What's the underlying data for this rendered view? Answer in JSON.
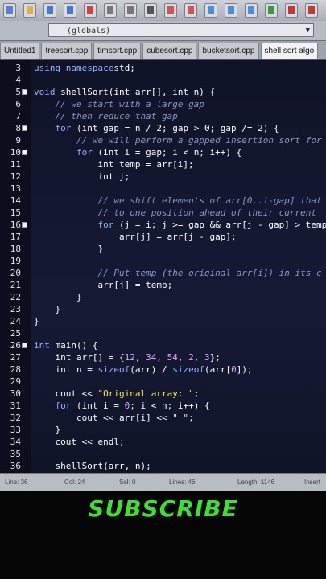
{
  "toolbar": {
    "icons": [
      "new-icon",
      "open-icon",
      "save-icon",
      "save-all-icon",
      "cut-icon",
      "copy-icon",
      "paste-icon",
      "print-icon",
      "undo-icon",
      "redo-icon",
      "find-icon",
      "replace-icon",
      "goto-icon",
      "run-icon",
      "debug-icon",
      "close-icon"
    ]
  },
  "scope": {
    "value": "(globals)"
  },
  "tabs": [
    {
      "label": "Untitled1"
    },
    {
      "label": "treesort.cpp"
    },
    {
      "label": "timsort.cpp"
    },
    {
      "label": "cubesort.cpp"
    },
    {
      "label": "bucketsort.cpp"
    },
    {
      "label": "shell sort algo"
    }
  ],
  "lines": [
    {
      "n": "3",
      "fold": "",
      "tokens": [
        [
          "kw",
          "using namespace"
        ],
        [
          "",
          "std;"
        ]
      ]
    },
    {
      "n": "4",
      "fold": "",
      "tokens": []
    },
    {
      "n": "5",
      "fold": "box",
      "tokens": [
        [
          "kw",
          "void"
        ],
        [
          "",
          " shellSort(int arr[], int n) {"
        ]
      ]
    },
    {
      "n": "6",
      "fold": "",
      "tokens": [
        [
          "",
          "    "
        ],
        [
          "cm",
          "// we start with a large gap"
        ]
      ]
    },
    {
      "n": "7",
      "fold": "",
      "tokens": [
        [
          "",
          "    "
        ],
        [
          "cm",
          "// then reduce that gap"
        ]
      ]
    },
    {
      "n": "8",
      "fold": "box",
      "tokens": [
        [
          "",
          "    "
        ],
        [
          "kw",
          "for"
        ],
        [
          "",
          " (int gap = n / 2; gap > 0; gap /= 2) {"
        ]
      ]
    },
    {
      "n": "9",
      "fold": "",
      "tokens": [
        [
          "",
          "        "
        ],
        [
          "cm",
          "// we will perform a gapped insertion sort for"
        ]
      ]
    },
    {
      "n": "10",
      "fold": "box",
      "tokens": [
        [
          "",
          "        "
        ],
        [
          "kw",
          "for"
        ],
        [
          "",
          " (int i = gap; i < n; i++) {"
        ]
      ]
    },
    {
      "n": "11",
      "fold": "",
      "tokens": [
        [
          "",
          "            int temp = arr[i];"
        ]
      ]
    },
    {
      "n": "12",
      "fold": "",
      "tokens": [
        [
          "",
          "            int j;"
        ]
      ]
    },
    {
      "n": "13",
      "fold": "",
      "tokens": []
    },
    {
      "n": "14",
      "fold": "",
      "tokens": [
        [
          "",
          "            "
        ],
        [
          "cm",
          "// we shift elements of arr[0..i-gap] that"
        ]
      ]
    },
    {
      "n": "15",
      "fold": "",
      "tokens": [
        [
          "",
          "            "
        ],
        [
          "cm",
          "// to one position ahead of their current"
        ]
      ]
    },
    {
      "n": "16",
      "fold": "box",
      "tokens": [
        [
          "",
          "            "
        ],
        [
          "kw",
          "for"
        ],
        [
          "",
          " (j = i; j >= gap && arr[j - gap] > temp"
        ]
      ]
    },
    {
      "n": "17",
      "fold": "",
      "tokens": [
        [
          "",
          "                arr[j] = arr[j - gap];"
        ]
      ]
    },
    {
      "n": "18",
      "fold": "",
      "tokens": [
        [
          "",
          "            }"
        ]
      ]
    },
    {
      "n": "19",
      "fold": "",
      "tokens": []
    },
    {
      "n": "20",
      "fold": "",
      "tokens": [
        [
          "",
          "            "
        ],
        [
          "cm",
          "// Put temp (the original arr[i]) in its c"
        ]
      ]
    },
    {
      "n": "21",
      "fold": "",
      "tokens": [
        [
          "",
          "            arr[j] = temp;"
        ]
      ]
    },
    {
      "n": "22",
      "fold": "",
      "tokens": [
        [
          "",
          "        }"
        ]
      ]
    },
    {
      "n": "23",
      "fold": "",
      "tokens": [
        [
          "",
          "    }"
        ]
      ]
    },
    {
      "n": "24",
      "fold": "",
      "tokens": [
        [
          "",
          "}"
        ]
      ]
    },
    {
      "n": "25",
      "fold": "",
      "tokens": []
    },
    {
      "n": "26",
      "fold": "box",
      "tokens": [
        [
          "kw",
          "int"
        ],
        [
          "",
          " main() {"
        ]
      ]
    },
    {
      "n": "27",
      "fold": "",
      "tokens": [
        [
          "",
          "    int arr[] = {"
        ],
        [
          "nm",
          "12"
        ],
        [
          "",
          ", "
        ],
        [
          "nm",
          "34"
        ],
        [
          "",
          ", "
        ],
        [
          "nm",
          "54"
        ],
        [
          "",
          ", "
        ],
        [
          "nm",
          "2"
        ],
        [
          "",
          ", "
        ],
        [
          "nm",
          "3"
        ],
        [
          "",
          "};"
        ]
      ]
    },
    {
      "n": "28",
      "fold": "",
      "tokens": [
        [
          "",
          "    int n = "
        ],
        [
          "kw",
          "sizeof"
        ],
        [
          "",
          "(arr) / "
        ],
        [
          "kw",
          "sizeof"
        ],
        [
          "",
          "(arr["
        ],
        [
          "nm",
          "0"
        ],
        [
          "",
          "]);"
        ]
      ]
    },
    {
      "n": "29",
      "fold": "",
      "tokens": []
    },
    {
      "n": "30",
      "fold": "",
      "tokens": [
        [
          "",
          "    cout << "
        ],
        [
          "st",
          "\"Original array: \""
        ],
        [
          "",
          ";"
        ]
      ]
    },
    {
      "n": "31",
      "fold": "",
      "tokens": [
        [
          "",
          "    "
        ],
        [
          "kw",
          "for"
        ],
        [
          "",
          " (int i = "
        ],
        [
          "nm",
          "0"
        ],
        [
          "",
          "; i < n; i++) {"
        ]
      ]
    },
    {
      "n": "32",
      "fold": "",
      "tokens": [
        [
          "",
          "        cout << arr[i] << "
        ],
        [
          "st",
          "\" \""
        ],
        [
          "",
          ";"
        ]
      ]
    },
    {
      "n": "33",
      "fold": "",
      "tokens": [
        [
          "",
          "    }"
        ]
      ]
    },
    {
      "n": "34",
      "fold": "",
      "tokens": [
        [
          "",
          "    cout << endl;"
        ]
      ]
    },
    {
      "n": "35",
      "fold": "",
      "tokens": []
    },
    {
      "n": "36",
      "fold": "",
      "tokens": [
        [
          "",
          "    shellSort(arr, n);"
        ]
      ]
    }
  ],
  "status": {
    "line": "Line: 36",
    "col": "Col: 24",
    "sel": "Sel: 0",
    "lines": "Lines: 46",
    "length": "Length: 1146",
    "ins": "Insert"
  },
  "overlay": {
    "text": "SUBSCRIBE"
  }
}
